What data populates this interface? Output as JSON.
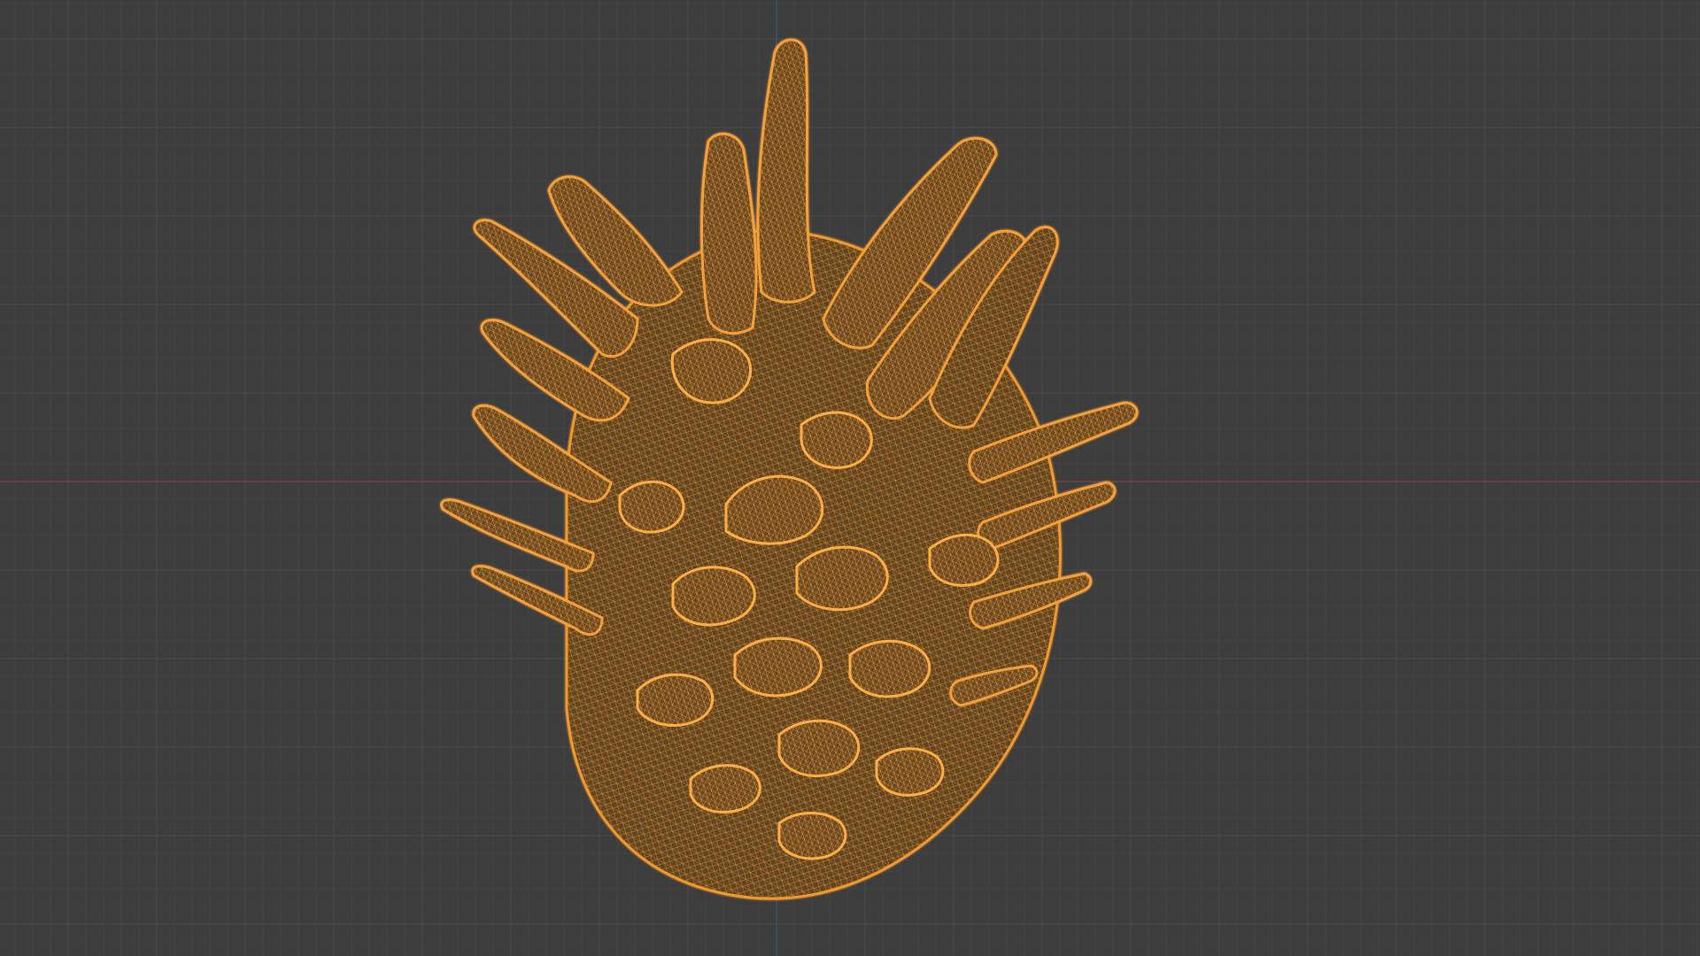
{
  "viewport": {
    "background_color": "#3d3d3d",
    "grid_minor_color": "#454545",
    "grid_major_color": "#4a4a4a",
    "x_axis_color": "#7a4646",
    "y_axis_color": "#3f5673",
    "show_grid": true,
    "shading_mode": "wireframe"
  },
  "object": {
    "name_icon": "pinecone-mesh",
    "wire_color": "#f2992e",
    "wire_dark_color": "#b86a1a",
    "fill_color": "#6e4c26"
  }
}
